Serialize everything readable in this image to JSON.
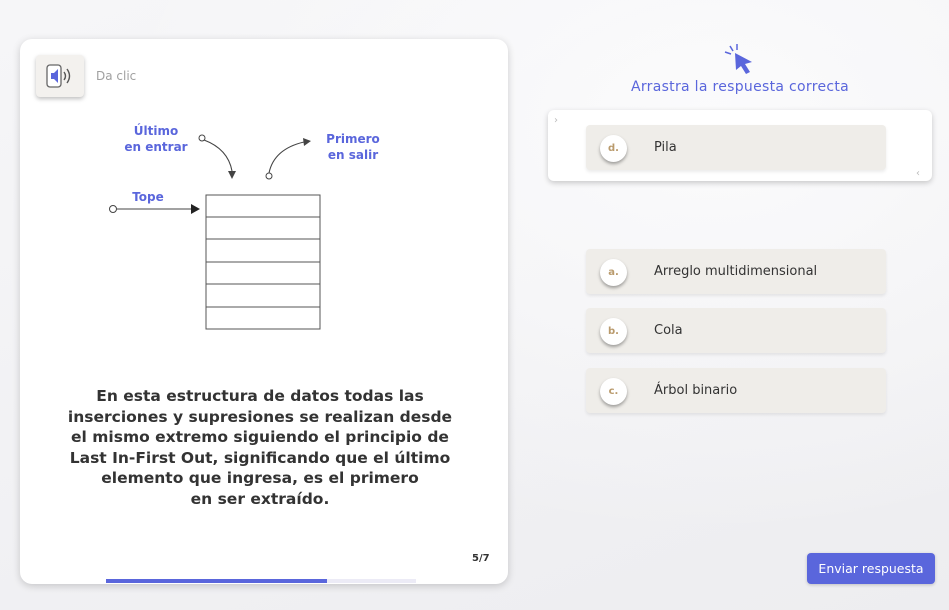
{
  "colors": {
    "accent": "#5a66dc",
    "option_bg": "#efede9",
    "letter_color": "#b99a6c"
  },
  "audio": {
    "icon": "speaker-icon",
    "label": "Da clic"
  },
  "diagram": {
    "labels": {
      "last_in_1": "Último",
      "last_in_2": "en entrar",
      "first_out_1": "Primero",
      "first_out_2": "en salir",
      "top": "Tope"
    }
  },
  "description": {
    "lines": [
      "En esta estructura de datos todas las",
      "inserciones y supresiones se realizan desde",
      "el mismo extremo siguiendo el principio de",
      "Last In-First Out, significando que el último",
      "elemento que ingresa, es el primero",
      "en ser extraído."
    ]
  },
  "pagination": {
    "label": "5/7",
    "progress": 0.714
  },
  "activity": {
    "hand_icon": "pointer-hand-icon",
    "instruction": "Arrastra la respuesta correcta",
    "drop_zone": {
      "arrow_left": "›",
      "arrow_right": "‹",
      "answer": {
        "letter": "d.",
        "text": "Pila"
      }
    },
    "options": [
      {
        "letter": "a.",
        "text": "Arreglo multidimensional"
      },
      {
        "letter": "b.",
        "text": "Cola"
      },
      {
        "letter": "c.",
        "text": "Árbol binario"
      }
    ]
  },
  "submit": {
    "label": "Enviar respuesta"
  }
}
